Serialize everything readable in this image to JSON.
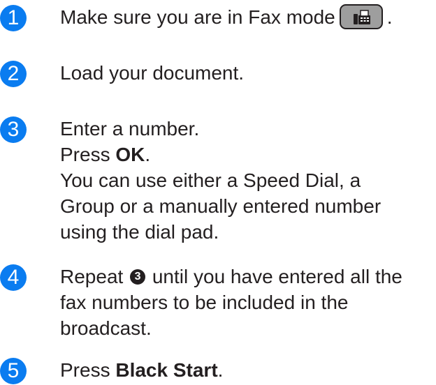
{
  "steps": [
    {
      "number": "1",
      "text_before_button": "Make sure you are in Fax mode",
      "button_icon": "fax-icon",
      "text_after_button": "."
    },
    {
      "number": "2",
      "text": "Load your document."
    },
    {
      "number": "3",
      "line1": "Enter a number.",
      "press_prefix": "Press ",
      "press_key": "OK",
      "press_suffix": ".",
      "note_lines": [
        "You can use either a Speed Dial, a",
        "Group or a manually entered number",
        "using the dial pad."
      ]
    },
    {
      "number": "4",
      "repeat_prefix": "Repeat ",
      "step_ref": "3",
      "repeat_suffix": " until you have entered all the",
      "lines": [
        "fax numbers to be included in the",
        "broadcast."
      ]
    },
    {
      "number": "5",
      "press_prefix": "Press ",
      "press_key": "Black Start",
      "press_suffix": "."
    }
  ],
  "colors": {
    "step_number_bg": "#0a7cf0",
    "text": "#231f20",
    "fax_button_bg": "#9e9e9e"
  }
}
